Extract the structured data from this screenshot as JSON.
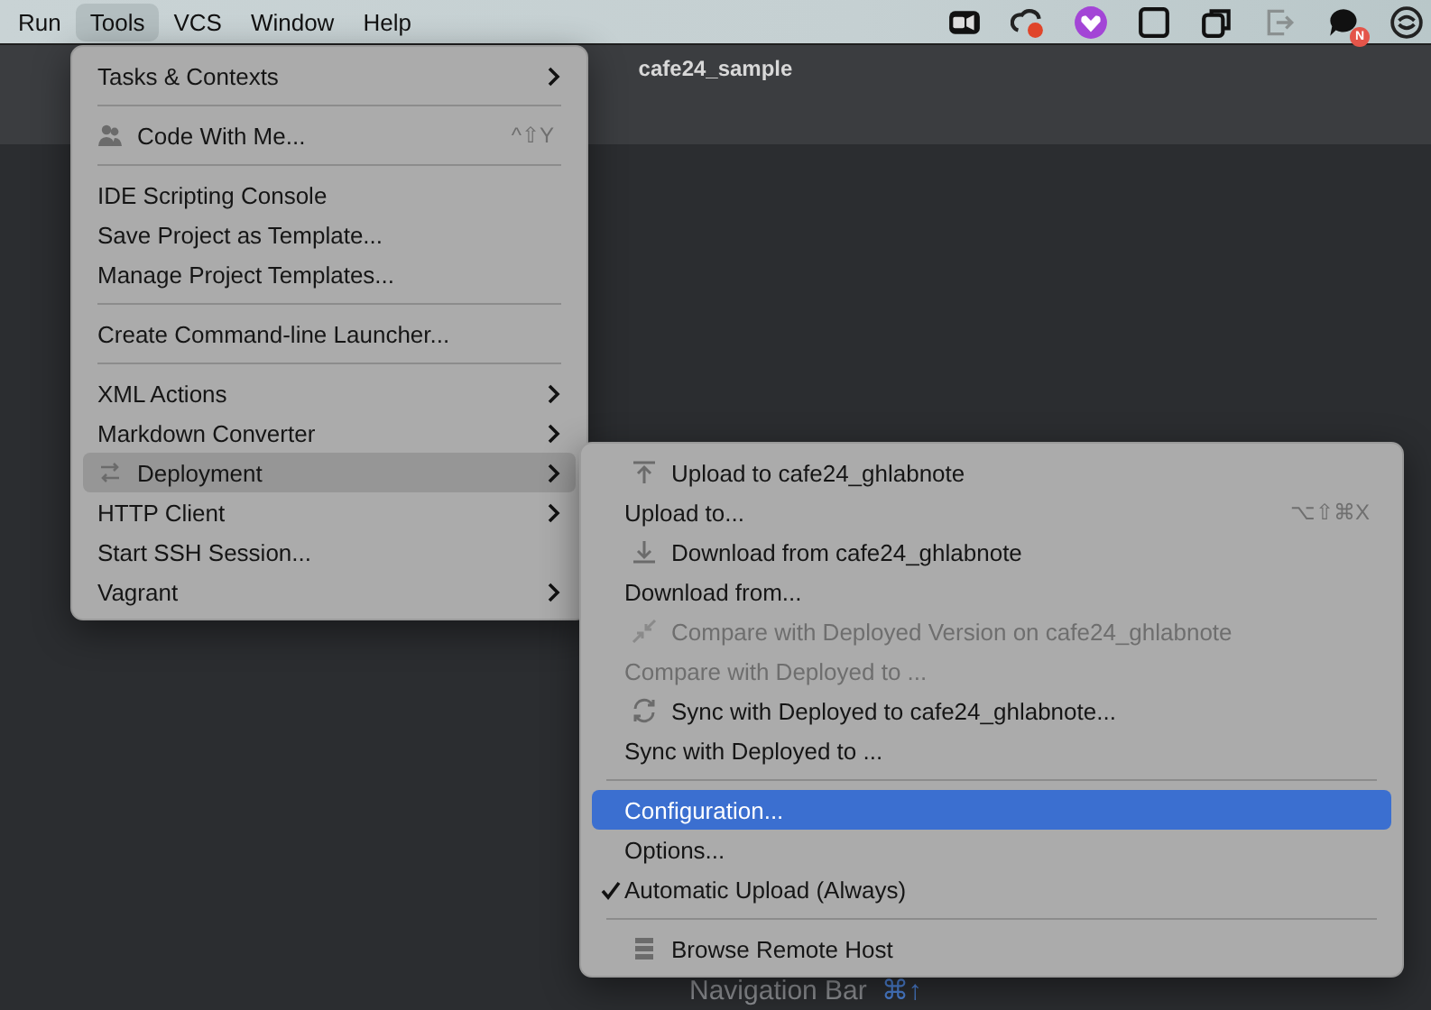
{
  "menu_bar": {
    "items": [
      {
        "label": "Run",
        "selected": false
      },
      {
        "label": "Tools",
        "selected": true
      },
      {
        "label": "VCS",
        "selected": false
      },
      {
        "label": "Window",
        "selected": false
      },
      {
        "label": "Help",
        "selected": false
      }
    ],
    "tray_icons": [
      {
        "kind": "camera"
      },
      {
        "kind": "cloud"
      },
      {
        "kind": "heart"
      },
      {
        "kind": "square"
      },
      {
        "kind": "copy"
      },
      {
        "kind": "exit"
      },
      {
        "kind": "chat",
        "badge": "N"
      },
      {
        "kind": "circle"
      }
    ]
  },
  "window": {
    "title": "cafe24_sample"
  },
  "hint": {
    "label": "Navigation Bar",
    "shortcut": "⌘↑"
  },
  "tools_menu": [
    {
      "kind": "item",
      "label": "Tasks & Contexts",
      "has_submenu": true,
      "selected": false,
      "disabled": false
    },
    {
      "kind": "separator"
    },
    {
      "kind": "people",
      "label": "Code With Me...",
      "shortcut": "^⇧Y",
      "has_submenu": false,
      "selected": false,
      "disabled": false
    },
    {
      "kind": "separator"
    },
    {
      "kind": "item",
      "label": "IDE Scripting Console",
      "has_submenu": false,
      "selected": false,
      "disabled": false
    },
    {
      "kind": "item",
      "label": "Save Project as Template...",
      "has_submenu": false,
      "selected": false,
      "disabled": false
    },
    {
      "kind": "item",
      "label": "Manage Project Templates...",
      "has_submenu": false,
      "selected": false,
      "disabled": false
    },
    {
      "kind": "separator"
    },
    {
      "kind": "item",
      "label": "Create Command-line Launcher...",
      "has_submenu": false,
      "selected": false,
      "disabled": false
    },
    {
      "kind": "separator"
    },
    {
      "kind": "item",
      "label": "XML Actions",
      "has_submenu": true,
      "selected": false,
      "disabled": false
    },
    {
      "kind": "item",
      "label": "Markdown Converter",
      "has_submenu": true,
      "selected": false,
      "disabled": false
    },
    {
      "kind": "swap",
      "label": "Deployment",
      "has_submenu": true,
      "selected": true,
      "disabled": false
    },
    {
      "kind": "item",
      "label": "HTTP Client",
      "has_submenu": true,
      "selected": false,
      "disabled": false
    },
    {
      "kind": "item",
      "label": "Start SSH Session...",
      "has_submenu": false,
      "selected": false,
      "disabled": false
    },
    {
      "kind": "item",
      "label": "Vagrant",
      "has_submenu": true,
      "selected": false,
      "disabled": false
    }
  ],
  "deployment_menu": [
    {
      "kind": "upload",
      "label": "Upload to cafe24_ghlabnote",
      "selected": false,
      "disabled": false,
      "checked": false
    },
    {
      "kind": "item",
      "label": "Upload to...",
      "shortcut": "⌥⇧⌘X",
      "selected": false,
      "disabled": false,
      "checked": false
    },
    {
      "kind": "download",
      "label": "Download from cafe24_ghlabnote",
      "selected": false,
      "disabled": false,
      "checked": false
    },
    {
      "kind": "item",
      "label": "Download from...",
      "selected": false,
      "disabled": false,
      "checked": false
    },
    {
      "kind": "compare",
      "label": "Compare with Deployed Version on cafe24_ghlabnote",
      "selected": false,
      "disabled": true,
      "checked": false
    },
    {
      "kind": "item",
      "label": "Compare with Deployed to ...",
      "selected": false,
      "disabled": true,
      "checked": false
    },
    {
      "kind": "sync",
      "label": "Sync with Deployed to cafe24_ghlabnote...",
      "selected": false,
      "disabled": false,
      "checked": false
    },
    {
      "kind": "item",
      "label": "Sync with Deployed to ...",
      "selected": false,
      "disabled": false,
      "checked": false
    },
    {
      "kind": "separator"
    },
    {
      "kind": "item",
      "label": "Configuration...",
      "selected": true,
      "disabled": false,
      "checked": false
    },
    {
      "kind": "item",
      "label": "Options...",
      "selected": false,
      "disabled": false,
      "checked": false
    },
    {
      "kind": "item",
      "label": "Automatic Upload (Always)",
      "selected": false,
      "disabled": false,
      "checked": true
    },
    {
      "kind": "separator"
    },
    {
      "kind": "server",
      "label": "Browse Remote Host",
      "selected": false,
      "disabled": false,
      "checked": false
    }
  ]
}
